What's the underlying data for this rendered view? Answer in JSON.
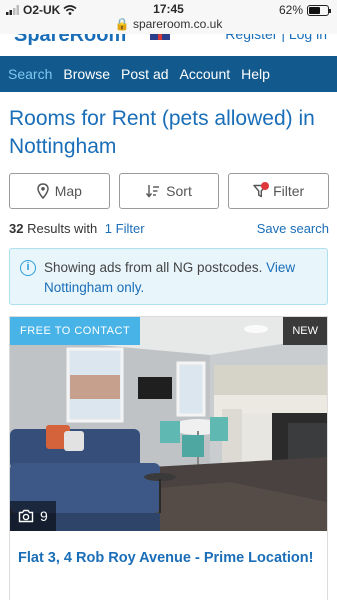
{
  "status_bar": {
    "carrier": "O2-UK",
    "time": "17:45",
    "url": "spareroom.co.uk",
    "battery": "62%",
    "battery_level": 0.62
  },
  "brand": {
    "logo": "SpareRoom",
    "links": "Register | Log in"
  },
  "nav": {
    "items": [
      {
        "label": "Search",
        "active": true
      },
      {
        "label": "Browse"
      },
      {
        "label": "Post ad"
      },
      {
        "label": "Account"
      },
      {
        "label": "Help"
      }
    ]
  },
  "page": {
    "title": "Rooms for Rent (pets allowed) in Nottingham"
  },
  "buttons": {
    "map": "Map",
    "sort": "Sort",
    "filter": "Filter"
  },
  "results": {
    "count": "32",
    "count_suffix": "Results with",
    "filter_link": "1 Filter",
    "save": "Save search"
  },
  "info": {
    "text": "Showing ads from all NG postcodes.",
    "link": "View Nottingham only."
  },
  "listing": {
    "badge_free": "FREE TO CONTACT",
    "badge_new": "NEW",
    "photo_count": "9",
    "title": "Flat 3, 4 Rob Roy Avenue - Prime Location!"
  },
  "colors": {
    "nav_bg": "#125a8e",
    "brand_blue": "#1a6eb8",
    "badge_blue": "#47b3e6",
    "info_bg": "#e8f5fb"
  }
}
